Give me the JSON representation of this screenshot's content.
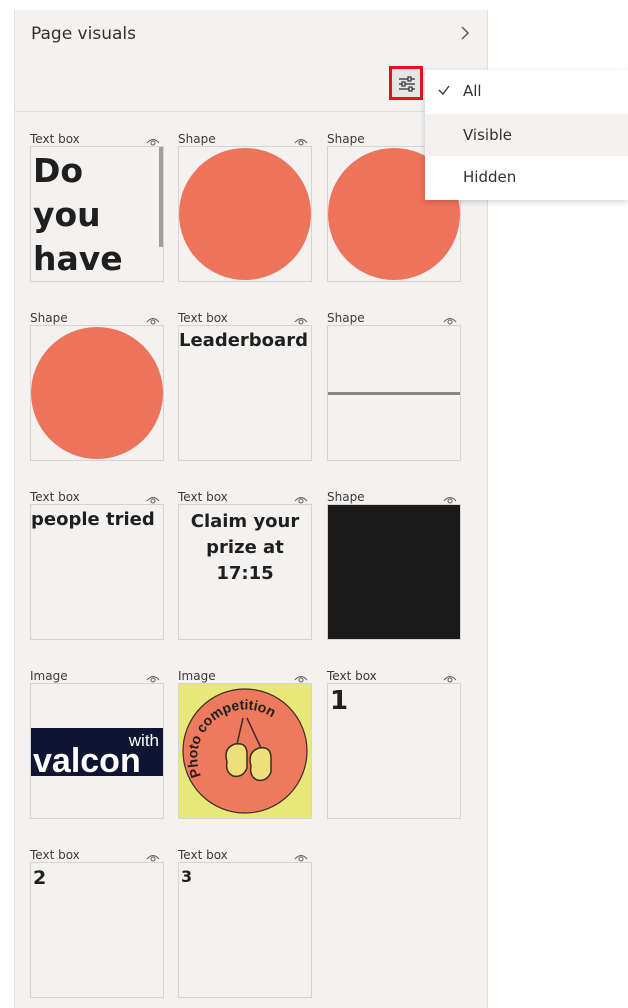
{
  "pane": {
    "title": "Page visuals"
  },
  "filter_menu": {
    "items": [
      {
        "label": "All",
        "checked": true
      },
      {
        "label": "Visible"
      },
      {
        "label": "Hidden"
      }
    ]
  },
  "visuals": [
    {
      "type": "Text box",
      "content": "Do you have Power"
    },
    {
      "type": "Shape"
    },
    {
      "type": "Shape"
    },
    {
      "type": "Shape"
    },
    {
      "type": "Text box",
      "content": "Leaderboard"
    },
    {
      "type": "Shape"
    },
    {
      "type": "Text box",
      "content": "people tried"
    },
    {
      "type": "Text box",
      "content": "Claim your prize at 17:15"
    },
    {
      "type": "Shape"
    },
    {
      "type": "Image",
      "content": "valcon",
      "content2": "with"
    },
    {
      "type": "Image",
      "content": "Photo competition"
    },
    {
      "type": "Text box",
      "content": "1"
    },
    {
      "type": "Text box",
      "content": "2"
    },
    {
      "type": "Text box",
      "content": "3"
    }
  ],
  "colors": {
    "shape_fill": "#ee735b",
    "highlight_border": "#e8101a"
  }
}
